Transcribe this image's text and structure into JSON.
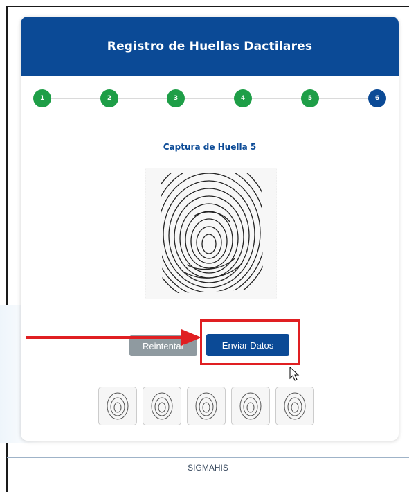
{
  "header": {
    "title": "Registro de Huellas Dactilares"
  },
  "steps": [
    {
      "label": "1",
      "state": "done"
    },
    {
      "label": "2",
      "state": "done"
    },
    {
      "label": "3",
      "state": "done"
    },
    {
      "label": "4",
      "state": "done"
    },
    {
      "label": "5",
      "state": "done"
    },
    {
      "label": "6",
      "state": "current"
    }
  ],
  "capture": {
    "title": "Captura de Huella 5"
  },
  "actions": {
    "retry_label": "Reintentar",
    "send_label": "Enviar Datos"
  },
  "thumbnails_count": 5,
  "footer": {
    "text": "SIGMAHIS"
  },
  "colors": {
    "brand_blue": "#0b4a96",
    "step_done_green": "#1e9e47",
    "retry_gray": "#8f9aa0",
    "annotation_red": "#e01f22"
  },
  "icons": {
    "fingerprint": "fingerprint-icon",
    "annotation_arrow": "arrow-right-icon",
    "cursor": "mouse-pointer-icon"
  }
}
